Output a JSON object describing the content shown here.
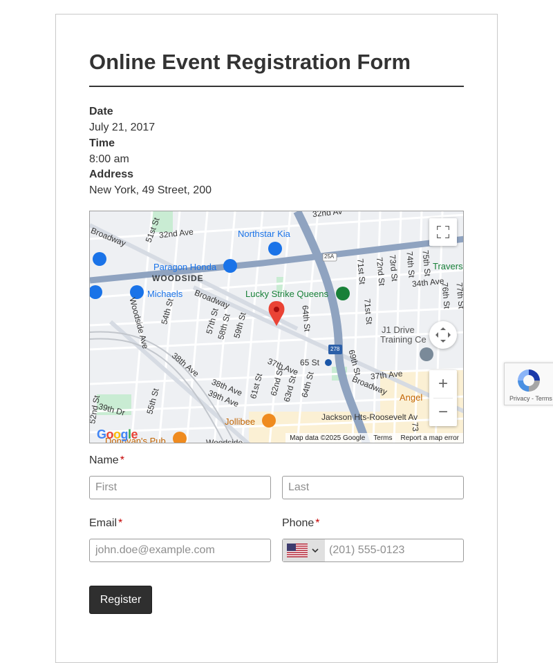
{
  "form": {
    "title": "Online Event Registration Form",
    "event": {
      "date_label": "Date",
      "date_value": "July 21, 2017",
      "time_label": "Time",
      "time_value": "8:00 am",
      "address_label": "Address",
      "address_value": "New York, 49 Street, 200"
    },
    "name": {
      "label": "Name",
      "required_mark": "*",
      "first_placeholder": "First",
      "last_placeholder": "Last"
    },
    "email": {
      "label": "Email",
      "required_mark": "*",
      "placeholder": "john.doe@example.com"
    },
    "phone": {
      "label": "Phone",
      "required_mark": "*",
      "country_flag": "us-flag-icon",
      "placeholder": "(201) 555-0123"
    },
    "submit_label": "Register"
  },
  "map": {
    "places": {
      "northstar": "Northstar Kia",
      "paragon": "Paragon Honda",
      "woodside": "WOODSIDE",
      "michaels": "Michaels",
      "lucky_strike": "Lucky Strike Queens",
      "travers": "Travers",
      "j1_line1": "J1 Drive",
      "j1_line2": "Training Ce",
      "angel": "Angel",
      "jollibee": "Jollibee",
      "jackson": "Jackson Hts-Roosevelt Av",
      "donovans": "Donovan's Pub",
      "woodside_bottom": "Woodside",
      "st65": "65 St"
    },
    "streets": {
      "broadway_a": "Broadway",
      "broadway_b": "Broadway",
      "broadway_c": "Broadway",
      "st51": "51st St",
      "ave32": "32nd Ave",
      "ave32b": "32nd Av",
      "ave34": "34th Ave",
      "ave37a": "37th Ave",
      "ave37b": "37th Ave",
      "ave38a": "38th Ave",
      "ave38b": "38th Ave",
      "ave39": "39th Ave",
      "dr39": "39th Dr",
      "woodside_ave": "Woodside Ave",
      "st54": "54th St",
      "st55": "55th St",
      "st52": "52nd St",
      "st57": "57th St",
      "st58": "58th St",
      "st59": "59th St",
      "st61": "61st St",
      "st62": "62nd St",
      "st63": "63rd St",
      "st64a": "64th St",
      "st64b": "64th St",
      "st69": "69th St",
      "st71a": "71st St",
      "st71b": "71st St",
      "st72": "72nd St",
      "st73": "73rd St",
      "st74": "74th St",
      "st75": "75th St",
      "st76": "76th St",
      "st77": "77th St",
      "hwy25a": "25A",
      "hwy278": "278",
      "st73b": "73"
    },
    "logo": "Google",
    "attribution": {
      "map_data": "Map data ©2025 Google",
      "terms": "Terms",
      "report": "Report a map error"
    },
    "controls": {
      "fullscreen": "fullscreen-icon",
      "camera": "camera-control-icon",
      "zoom_in": "+",
      "zoom_out": "−"
    }
  },
  "recaptcha": {
    "privacy": "Privacy",
    "separator": " - ",
    "terms": "Terms"
  },
  "colors": {
    "title": "#333333",
    "button_bg": "#2f2f2f",
    "required": "#c40000",
    "map_highway": "#8fa3c0",
    "map_pin": "#ea4335"
  }
}
